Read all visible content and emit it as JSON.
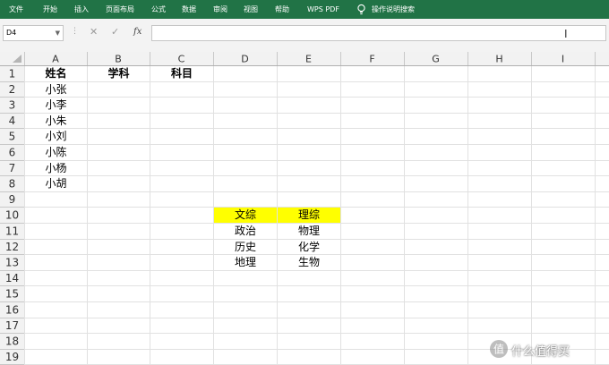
{
  "ribbon": {
    "tabs": [
      "文件",
      "开始",
      "插入",
      "页面布局",
      "公式",
      "数据",
      "审阅",
      "视图",
      "帮助",
      "WPS PDF"
    ],
    "tell_me": "操作说明搜索",
    "lightbulb_icon": "lightbulb-icon"
  },
  "formula_bar": {
    "name_box": "D4",
    "cancel_glyph": "✕",
    "enter_glyph": "✓",
    "fx_label": "fx",
    "formula_value": ""
  },
  "columns": [
    "A",
    "B",
    "C",
    "D",
    "E",
    "F",
    "G",
    "H",
    "I"
  ],
  "rows": [
    "1",
    "2",
    "3",
    "4",
    "5",
    "6",
    "7",
    "8",
    "9",
    "10",
    "11",
    "12",
    "13",
    "14",
    "15",
    "16",
    "17",
    "18",
    "19"
  ],
  "cells": {
    "A1": "姓名",
    "B1": "学科",
    "C1": "科目",
    "A2": "小张",
    "A3": "小李",
    "A4": "小朱",
    "A5": "小刘",
    "A6": "小陈",
    "A7": "小杨",
    "A8": "小胡",
    "D10": "文综",
    "E10": "理综",
    "D11": "政治",
    "E11": "物理",
    "D12": "历史",
    "E12": "化学",
    "D13": "地理",
    "E13": "生物"
  },
  "colors": {
    "ribbon": "#217346",
    "highlight": "#ffff00",
    "grid": "#e1e1e1"
  },
  "watermark": {
    "text": "什么值得买"
  }
}
